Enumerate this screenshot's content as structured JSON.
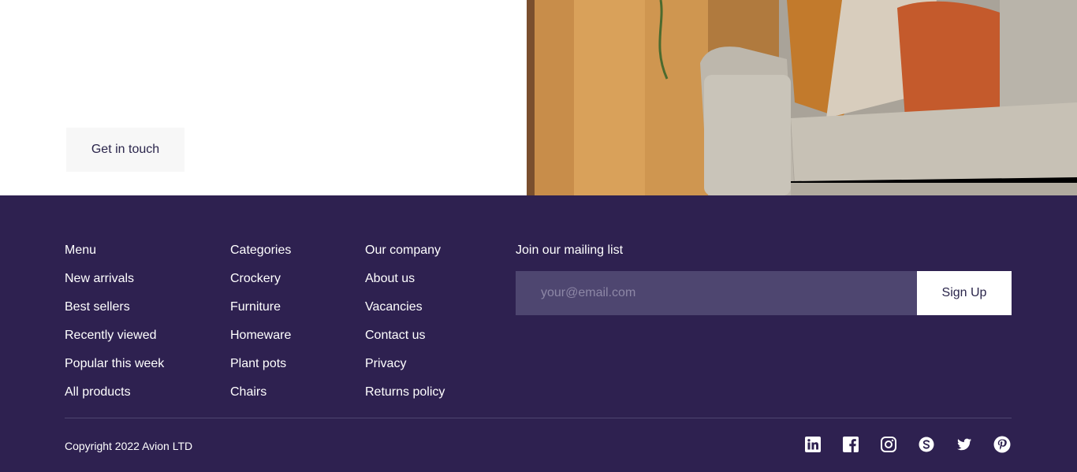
{
  "cta": {
    "get_in_touch_label": "Get in touch"
  },
  "footer": {
    "menu": {
      "title": "Menu",
      "items": [
        "New arrivals",
        "Best sellers",
        "Recently viewed",
        "Popular this week",
        "All products"
      ]
    },
    "categories": {
      "title": "Categories",
      "items": [
        "Crockery",
        "Furniture",
        "Homeware",
        "Plant pots",
        "Chairs"
      ]
    },
    "company": {
      "title": "Our company",
      "items": [
        "About us",
        "Vacancies",
        "Contact us",
        "Privacy",
        "Returns policy"
      ]
    },
    "mailing": {
      "title": "Join our mailing list",
      "placeholder": "your@email.com",
      "signup_label": "Sign Up"
    },
    "copyright": "Copyright 2022 Avion LTD",
    "socials": [
      "linkedin-icon",
      "facebook-icon",
      "instagram-icon",
      "skype-icon",
      "twitter-icon",
      "pinterest-icon"
    ]
  },
  "colors": {
    "footer_bg": "#2e2150",
    "input_bg": "#4e4670",
    "text_dark": "#2a254b",
    "button_light": "#f7f7f7"
  }
}
